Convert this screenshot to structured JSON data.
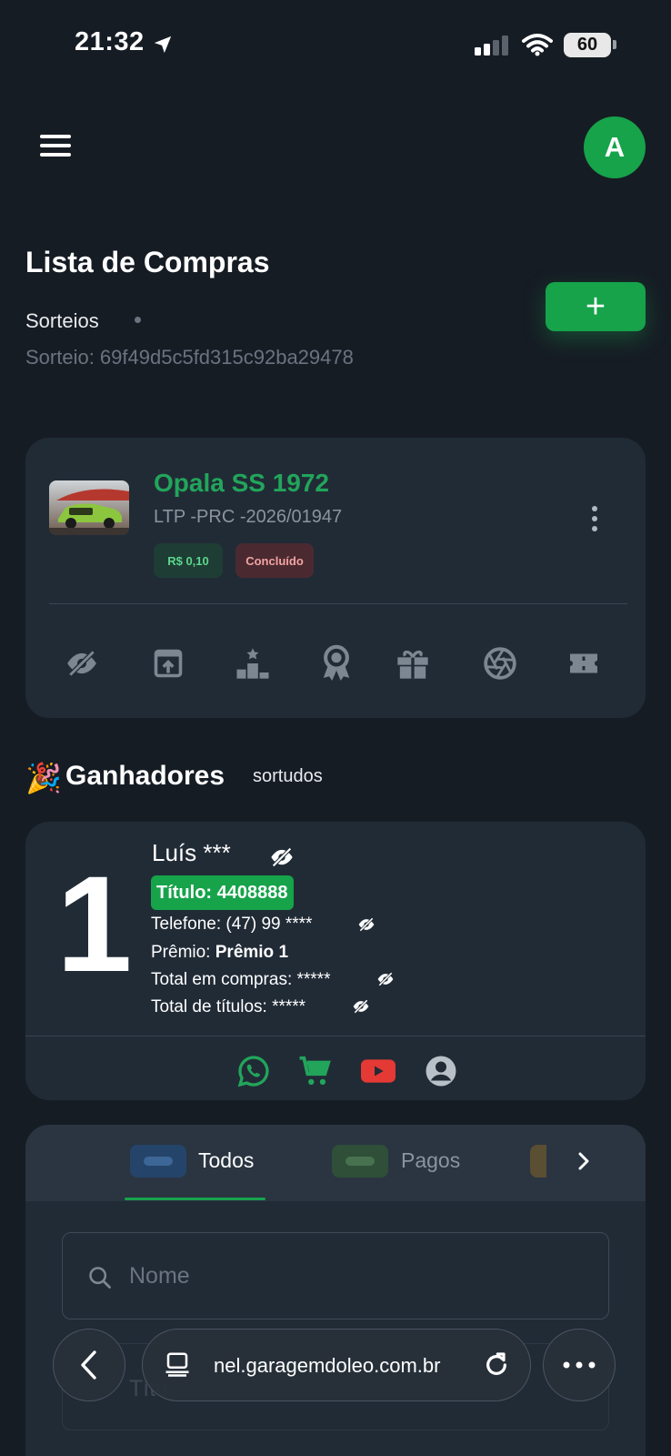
{
  "status_bar": {
    "time": "21:32",
    "battery": "60"
  },
  "header": {
    "avatar_initial": "A"
  },
  "page": {
    "title": "Lista de Compras",
    "breadcrumb": "Sorteios",
    "sorteio_id": "Sorteio: 69f49d5c5fd315c92ba29478",
    "add_label": "+"
  },
  "raffle": {
    "name": "Opala SS 1972",
    "code": "LTP -PRC -2026/01947",
    "price": "R$ 0,10",
    "status": "Concluído",
    "actions": [
      "eye-off-icon",
      "open-external-icon",
      "podium-icon",
      "award-icon",
      "gift-icon",
      "aperture-icon",
      "ticket-icon"
    ]
  },
  "winners": {
    "emoji": "🎉",
    "title": "Ganhadores",
    "subtitle": "sortudos",
    "items": [
      {
        "rank": "1",
        "name": "Luís ***",
        "title_badge": "Título: 4408888",
        "phone": "Telefone: (47) 99 ****",
        "prize_label": "Prêmio: ",
        "prize_value": "Prêmio 1",
        "total_purchases": "Total em compras: *****",
        "total_titles": "Total de títulos: *****"
      }
    ]
  },
  "tabs": {
    "items": [
      {
        "label": "Todos",
        "active": true
      },
      {
        "label": "Pagos",
        "active": false
      }
    ]
  },
  "search": {
    "placeholder": "Nome",
    "second_placeholder": "Títu"
  },
  "browser": {
    "url": "nel.garagemdoleo.com.br"
  },
  "colors": {
    "accent": "#16a34a",
    "background": "#161c24",
    "card": "#212b36"
  }
}
